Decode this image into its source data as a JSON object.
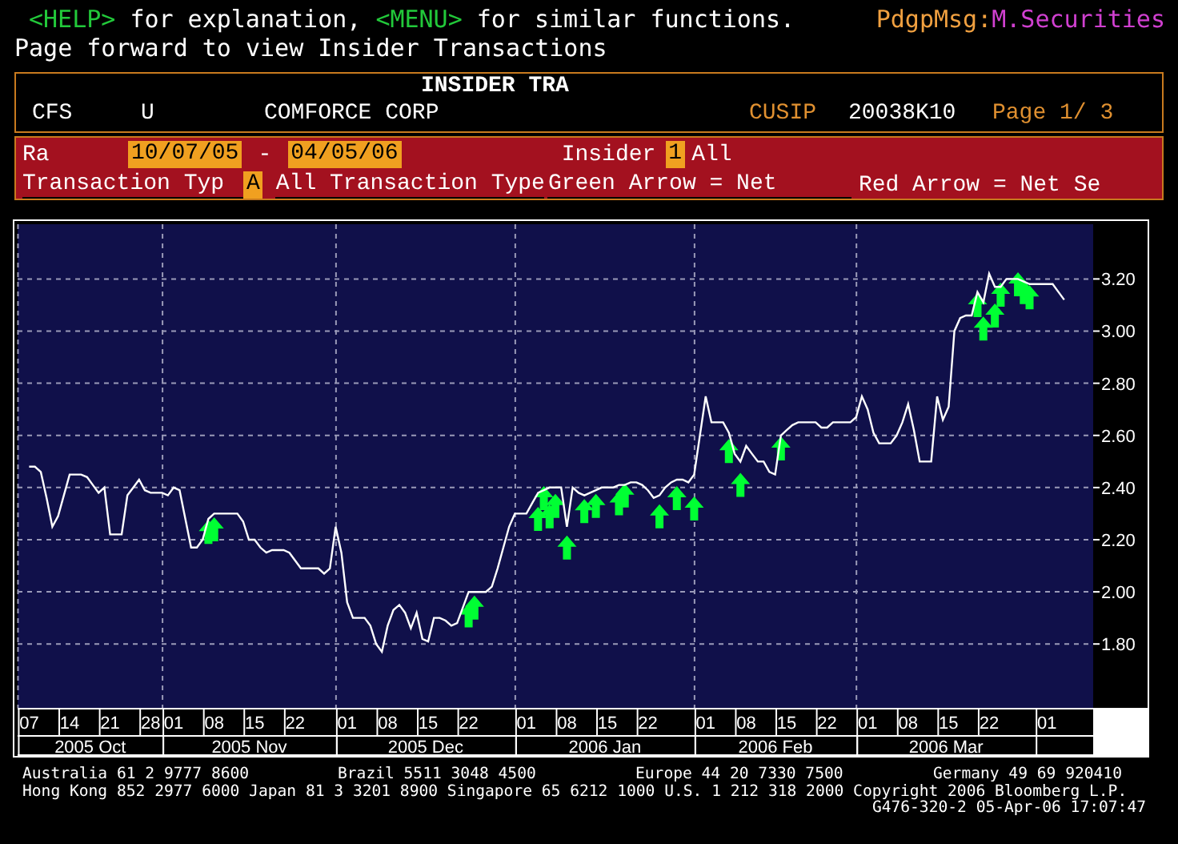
{
  "help_line": [
    {
      "text": "<HELP>",
      "kind": "key"
    },
    {
      "text": "for explanation,",
      "kind": "plain"
    },
    {
      "text": "<MENU>",
      "kind": "key"
    },
    {
      "text": "for similar functions.",
      "kind": "plain"
    }
  ],
  "message": {
    "label": "PdgpMsg:",
    "value": "M.Securities"
  },
  "subtitle": "Page forward to view Insider Transactions",
  "header": {
    "title": "INSIDER TRA",
    "ticker": "CFS",
    "market": "U",
    "company": "COMFORCE CORP",
    "cusip_label": "CUSIP",
    "cusip": "20038K10",
    "page": "Page 1/ 3"
  },
  "filters": {
    "range_label": "Ra",
    "start_date": "10/07/05",
    "separator": "-",
    "end_date": "04/05/06",
    "insider_label": "Insider",
    "insider_code": "1",
    "insider_value": "All",
    "type_label": "Transaction Typ",
    "type_code": "A",
    "type_value": "All Transaction Type",
    "green_legend": "Green Arrow = Net",
    "red_legend": "Red Arrow = Net Se"
  },
  "chart": {
    "chart_data": {
      "type": "line",
      "grid": true,
      "categories": [
        null,
        null,
        "07",
        null,
        null,
        null,
        null,
        null,
        null,
        "14",
        null,
        null,
        null,
        null,
        null,
        null,
        "21",
        null,
        null,
        null,
        null,
        null,
        null,
        "28",
        null,
        null,
        null,
        "01",
        null,
        null,
        null,
        null,
        null,
        null,
        "08",
        null,
        null,
        null,
        null,
        null,
        null,
        "15",
        null,
        null,
        null,
        null,
        null,
        null,
        "22",
        null,
        null,
        null,
        null,
        null,
        null,
        null,
        null,
        "01",
        null,
        null,
        null,
        null,
        null,
        null,
        "08",
        null,
        null,
        null,
        null,
        null,
        null,
        "15",
        null,
        null,
        null,
        null,
        null,
        null,
        "22",
        null,
        null,
        null,
        null,
        null,
        null,
        null,
        null,
        null,
        "01",
        null,
        null,
        null,
        null,
        null,
        null,
        "08",
        null,
        null,
        null,
        null,
        null,
        null,
        "15",
        null,
        null,
        null,
        null,
        null,
        null,
        "22",
        null,
        null,
        null,
        null,
        null,
        null,
        null,
        null,
        null,
        "01",
        null,
        null,
        null,
        null,
        null,
        null,
        "08",
        null,
        null,
        null,
        null,
        null,
        null,
        "15",
        null,
        null,
        null,
        null,
        null,
        null,
        "22",
        null,
        null,
        null,
        null,
        null,
        null,
        "01",
        null,
        null,
        null,
        null,
        null,
        null,
        "08",
        null,
        null,
        null,
        null,
        null,
        null,
        "15",
        null,
        null,
        null,
        null,
        null,
        null,
        "22",
        null,
        null,
        null,
        null,
        null,
        null,
        null,
        null,
        null,
        "01",
        null,
        null,
        null,
        null,
        null,
        null,
        null,
        null
      ],
      "series": [
        {
          "color": "#ffffff",
          "values": [
            null,
            null,
            2.48,
            2.48,
            2.46,
            2.36,
            2.25,
            2.29,
            2.37,
            2.45,
            2.45,
            2.45,
            2.44,
            2.41,
            2.38,
            2.4,
            2.22,
            2.22,
            2.22,
            2.37,
            2.4,
            2.43,
            2.39,
            2.38,
            2.38,
            2.38,
            2.37,
            2.4,
            2.39,
            2.28,
            2.17,
            2.17,
            2.2,
            2.28,
            2.3,
            2.3,
            2.3,
            2.3,
            2.3,
            2.27,
            2.2,
            2.2,
            2.17,
            2.15,
            2.16,
            2.16,
            2.16,
            2.15,
            2.12,
            2.09,
            2.09,
            2.09,
            2.09,
            2.07,
            2.09,
            2.25,
            2.15,
            1.96,
            1.9,
            1.9,
            1.9,
            1.87,
            1.8,
            1.77,
            1.87,
            1.93,
            1.95,
            1.92,
            1.86,
            1.92,
            1.82,
            1.81,
            1.9,
            1.9,
            1.89,
            1.87,
            1.88,
            1.94,
            2.0,
            2.0,
            2.0,
            2.0,
            2.02,
            2.09,
            2.17,
            2.25,
            2.3,
            2.3,
            2.3,
            2.34,
            2.38,
            2.39,
            2.4,
            2.4,
            2.4,
            2.25,
            2.4,
            2.38,
            2.37,
            2.38,
            2.39,
            2.4,
            2.4,
            2.4,
            2.41,
            2.41,
            2.42,
            2.42,
            2.41,
            2.39,
            2.36,
            2.37,
            2.4,
            2.42,
            2.43,
            2.43,
            2.42,
            2.45,
            2.6,
            2.75,
            2.65,
            2.65,
            2.65,
            2.61,
            2.53,
            2.5,
            2.56,
            2.53,
            2.5,
            2.5,
            2.46,
            2.45,
            2.6,
            2.62,
            2.64,
            2.65,
            2.65,
            2.65,
            2.65,
            2.63,
            2.63,
            2.65,
            2.65,
            2.65,
            2.65,
            2.67,
            2.75,
            2.7,
            2.61,
            2.57,
            2.57,
            2.57,
            2.6,
            2.65,
            2.72,
            2.62,
            2.5,
            2.5,
            2.5,
            2.75,
            2.66,
            2.71,
            3.0,
            3.05,
            3.06,
            3.06,
            3.15,
            3.11,
            3.22,
            3.17,
            3.17,
            3.2,
            3.2,
            3.2,
            3.19,
            3.18,
            3.18,
            3.18,
            3.18,
            3.18,
            3.15,
            3.12,
            null,
            null,
            null,
            null,
            null
          ]
        },
        {
          "color": "#00ff33",
          "type": "scatter",
          "values": [
            null,
            null,
            null,
            null,
            null,
            null,
            null,
            null,
            null,
            null,
            null,
            null,
            null,
            null,
            null,
            null,
            null,
            null,
            null,
            null,
            null,
            null,
            null,
            null,
            null,
            null,
            null,
            null,
            null,
            null,
            null,
            null,
            null,
            2.23,
            2.24,
            null,
            null,
            null,
            null,
            null,
            null,
            null,
            null,
            null,
            null,
            null,
            null,
            null,
            null,
            null,
            null,
            null,
            null,
            null,
            null,
            null,
            null,
            null,
            null,
            null,
            null,
            null,
            null,
            null,
            null,
            null,
            null,
            null,
            null,
            null,
            null,
            null,
            null,
            null,
            null,
            null,
            null,
            null,
            1.91,
            1.94,
            null,
            null,
            null,
            null,
            null,
            null,
            null,
            null,
            null,
            null,
            2.28,
            2.36,
            2.29,
            2.33,
            null,
            2.17,
            null,
            null,
            2.31,
            null,
            2.33,
            null,
            null,
            null,
            2.34,
            2.37,
            null,
            null,
            null,
            null,
            null,
            2.29,
            null,
            null,
            2.36,
            null,
            null,
            2.32,
            null,
            null,
            null,
            null,
            null,
            2.54,
            null,
            2.41,
            null,
            null,
            null,
            null,
            null,
            null,
            2.55,
            null,
            null,
            null,
            null,
            null,
            null,
            null,
            null,
            null,
            null,
            null,
            null,
            null,
            null,
            null,
            null,
            null,
            null,
            null,
            null,
            null,
            null,
            null,
            null,
            null,
            null,
            null,
            null,
            null,
            null,
            null,
            null,
            null,
            3.1,
            3.01,
            null,
            3.06,
            3.14,
            null,
            null,
            3.18,
            3.15,
            3.13,
            null,
            null,
            null,
            null,
            null,
            null,
            null,
            null,
            null,
            null,
            null
          ]
        }
      ],
      "ylim": [
        1.555,
        3.41
      ],
      "yticks": [
        {
          "value": 1.8,
          "label": "1.80"
        },
        {
          "value": 2.0,
          "label": "2.00"
        },
        {
          "value": 2.2,
          "label": "2.20"
        },
        {
          "value": 2.4,
          "label": "2.40"
        },
        {
          "value": 2.6,
          "label": "2.60"
        },
        {
          "value": 2.8,
          "label": "2.80"
        },
        {
          "value": 3.0,
          "label": "3.00"
        },
        {
          "value": 3.2,
          "label": "3.20"
        }
      ],
      "annotations": [
        "2005 Oct",
        "2005 Nov",
        "2005 Dec",
        "2006 Jan",
        "2006 Feb",
        "2006 Mar"
      ]
    }
  },
  "footer": [
    [
      "Australia 61 2 9777 8600",
      "Brazil 5511 3048 4500",
      "Europe 44 20 7330 7500",
      "Germany 49 69 920410"
    ],
    [
      "Hong Kong 852 2977 6000 Japan 81 3 3201 8900 Singapore 65 6212 1000 U.S. 1 212 318 2000 Copyright 2006 Bloomberg L.P."
    ],
    [
      "G476-320-2 05-Apr-06 17:07:47"
    ]
  ]
}
